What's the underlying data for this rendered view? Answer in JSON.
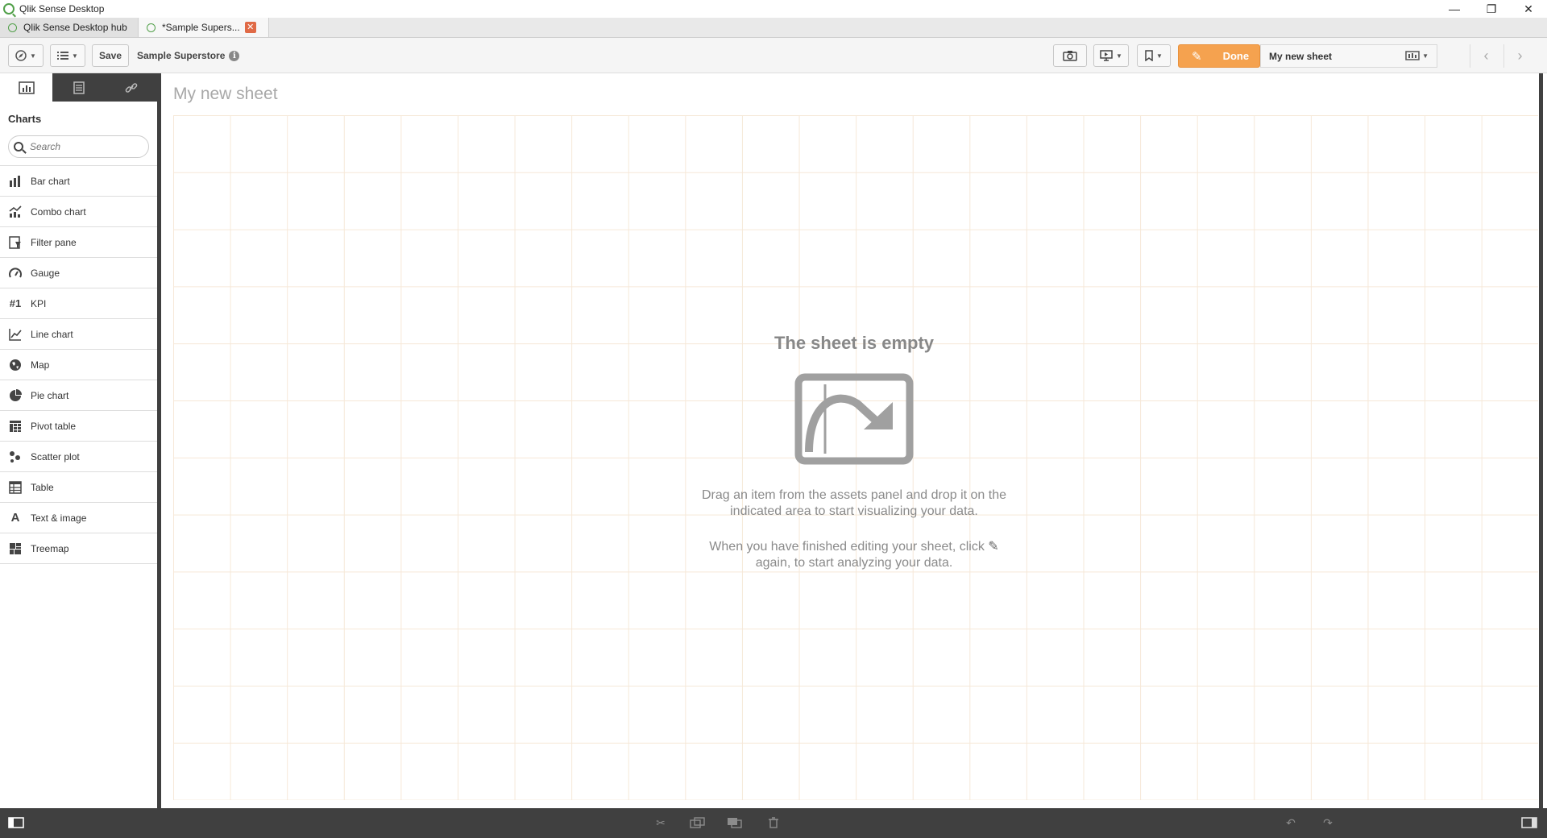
{
  "window": {
    "title": "Qlik Sense Desktop",
    "controls": [
      "—",
      "❐",
      "✕"
    ]
  },
  "tabs": [
    {
      "label": "Qlik Sense Desktop hub",
      "active": false
    },
    {
      "label": "*Sample Supers...",
      "active": true,
      "close": "✕"
    }
  ],
  "toolbar": {
    "save_label": "Save",
    "app_name": "Sample Superstore",
    "info_glyph": "i",
    "done_label": "Done",
    "sheet_title": "My new sheet",
    "prev_glyph": "‹",
    "next_glyph": "›",
    "accent_color": "#f5a24f"
  },
  "assets": {
    "heading": "Charts",
    "search_placeholder": "Search",
    "items": [
      {
        "label": "Bar chart",
        "icon": "bar-chart-icon"
      },
      {
        "label": "Combo chart",
        "icon": "combo-chart-icon"
      },
      {
        "label": "Filter pane",
        "icon": "filter-pane-icon"
      },
      {
        "label": "Gauge",
        "icon": "gauge-icon"
      },
      {
        "label": "KPI",
        "icon": "kpi-icon"
      },
      {
        "label": "Line chart",
        "icon": "line-chart-icon"
      },
      {
        "label": "Map",
        "icon": "map-icon"
      },
      {
        "label": "Pie chart",
        "icon": "pie-chart-icon"
      },
      {
        "label": "Pivot table",
        "icon": "pivot-table-icon"
      },
      {
        "label": "Scatter plot",
        "icon": "scatter-plot-icon"
      },
      {
        "label": "Table",
        "icon": "table-icon"
      },
      {
        "label": "Text & image",
        "icon": "text-image-icon"
      },
      {
        "label": "Treemap",
        "icon": "treemap-icon"
      }
    ]
  },
  "sheet": {
    "title": "My new sheet",
    "empty_title": "The sheet is empty",
    "empty_line1": "Drag an item from the assets panel and drop it on the indicated area to start visualizing your data.",
    "empty_line2a": "When you have finished editing your sheet, click",
    "empty_line2b": "again, to start analyzing your data."
  }
}
